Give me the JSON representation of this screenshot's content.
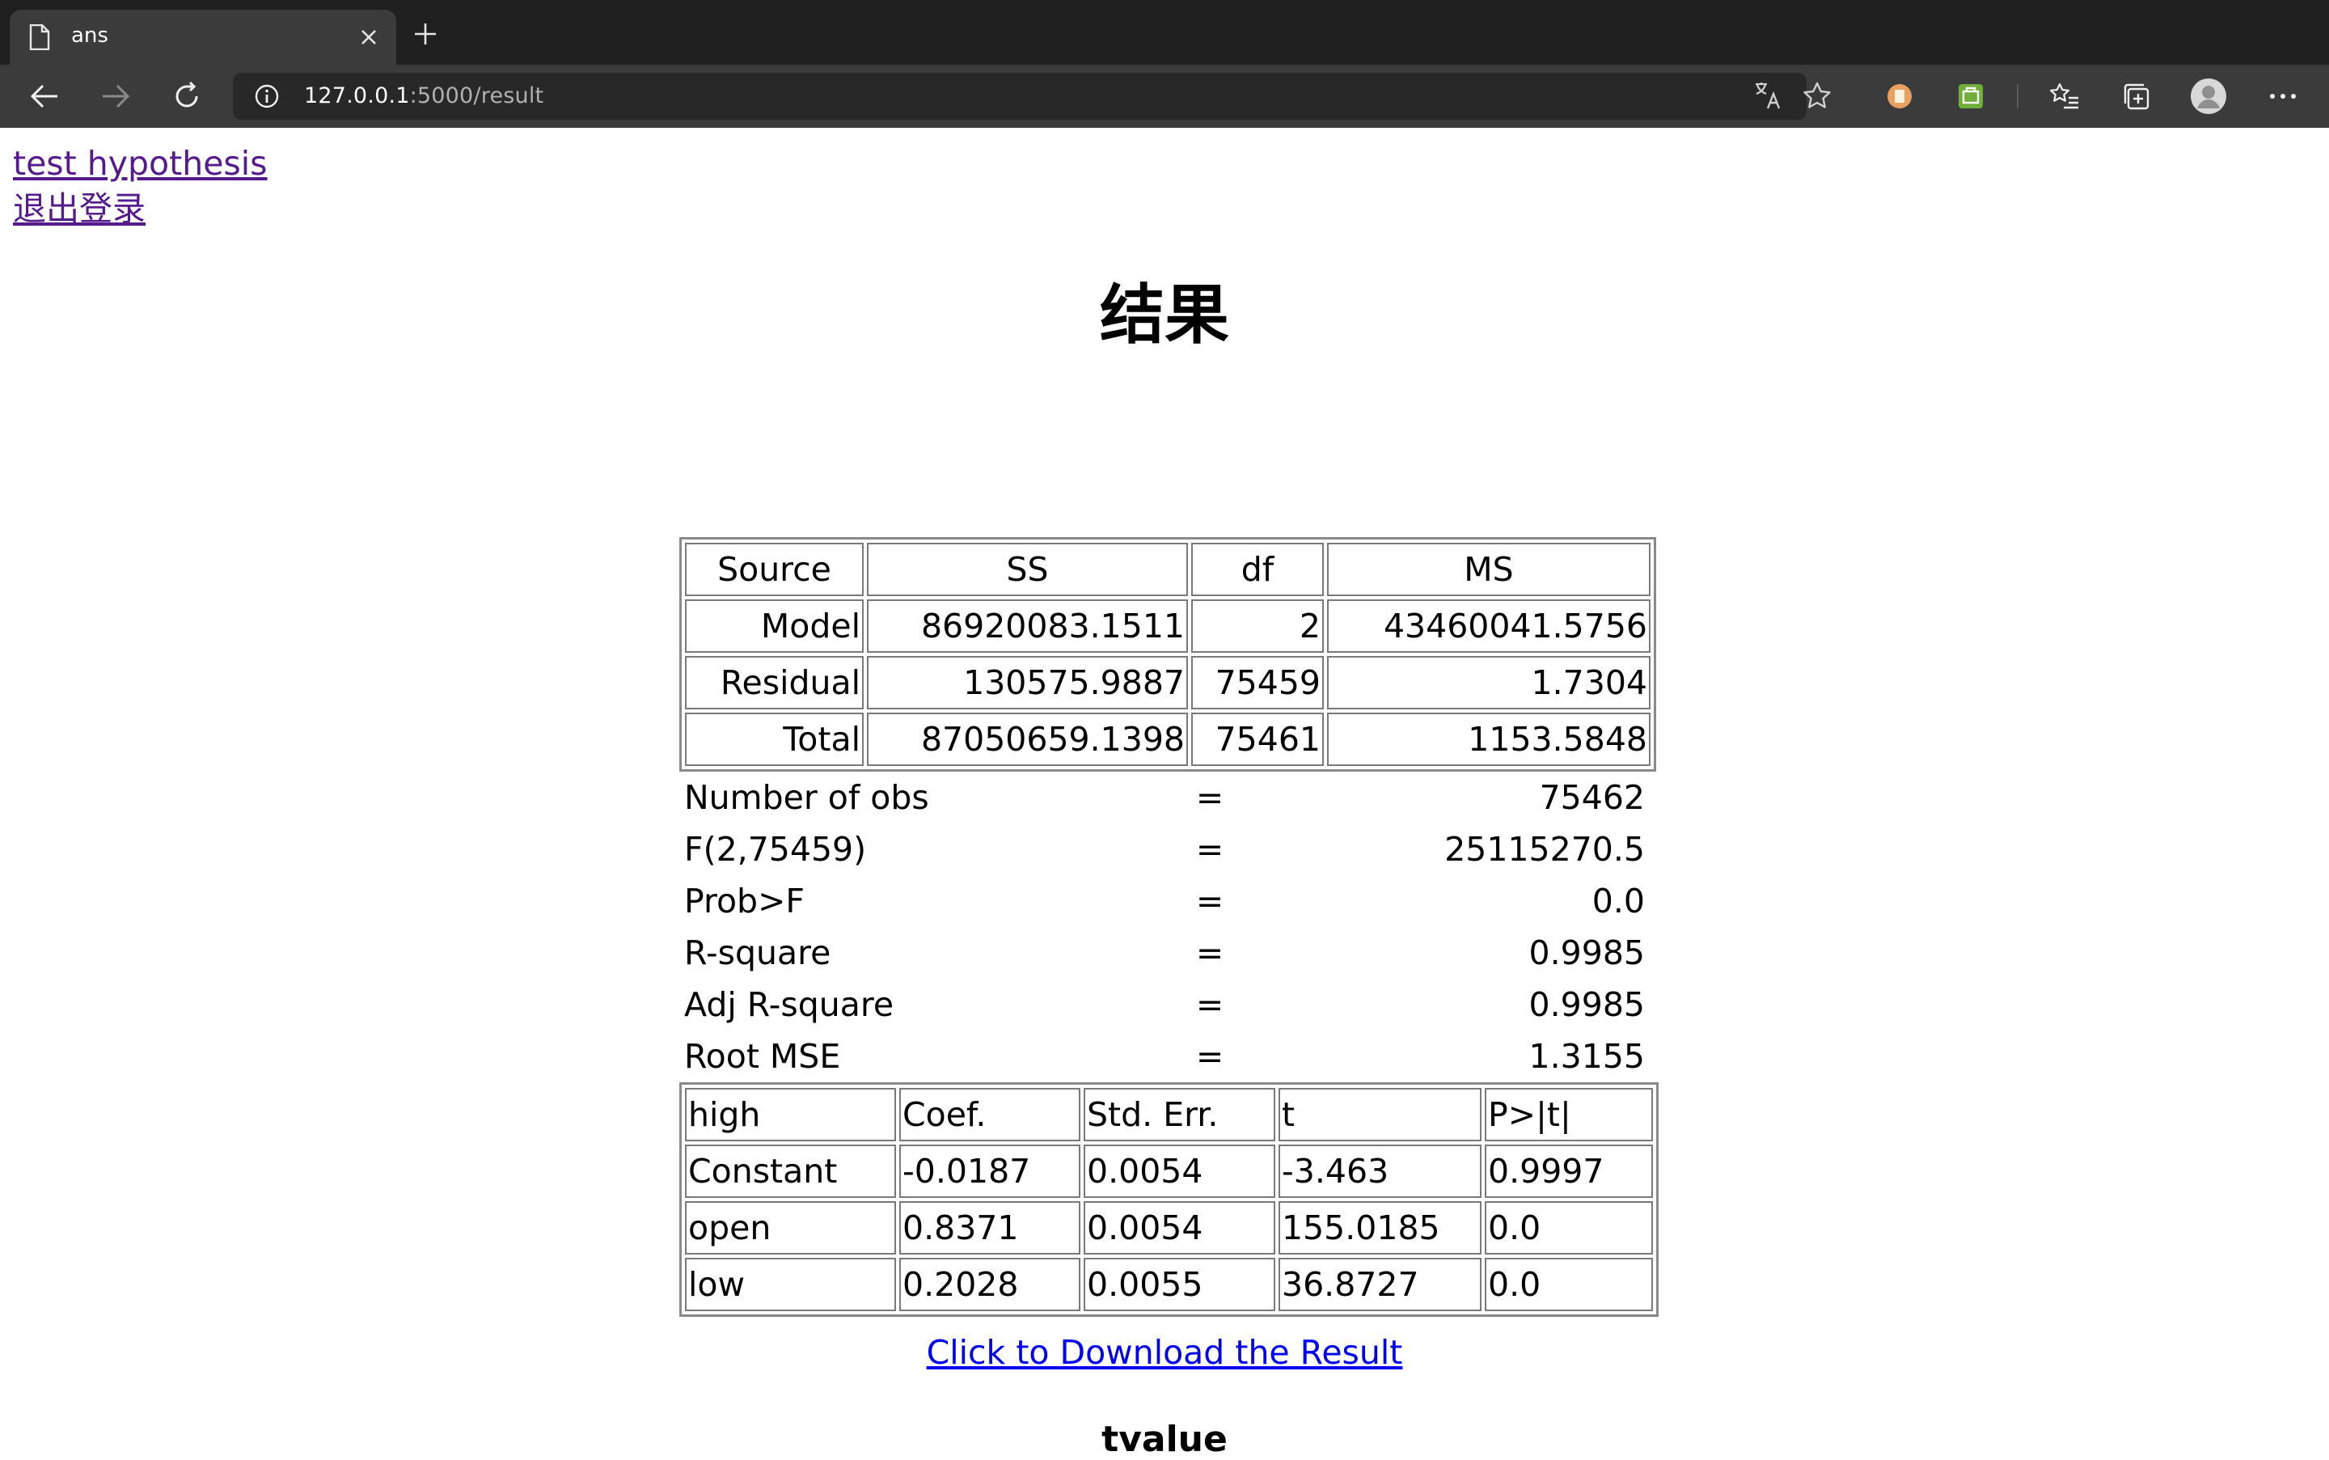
{
  "browser": {
    "tab_title": "ans",
    "url_host": "127.0.0.1",
    "url_path": ":5000/result"
  },
  "nav": {
    "links": [
      "test hypothesis",
      "退出登录"
    ]
  },
  "page": {
    "title": "结果",
    "download_link": "Click to Download the Result",
    "subheading": "tvalue"
  },
  "anova": {
    "headers": [
      "Source",
      "SS",
      "df",
      "MS"
    ],
    "rows": [
      [
        "Model",
        "86920083.1511",
        "2",
        "43460041.5756"
      ],
      [
        "Residual",
        "130575.9887",
        "75459",
        "1.7304"
      ],
      [
        "Total",
        "87050659.1398",
        "75461",
        "1153.5848"
      ]
    ]
  },
  "stats": [
    {
      "label": "Number of obs",
      "eq": "=",
      "value": "75462"
    },
    {
      "label": "F(2,75459)",
      "eq": "=",
      "value": "25115270.5"
    },
    {
      "label": "Prob>F",
      "eq": "=",
      "value": "0.0"
    },
    {
      "label": "R-square",
      "eq": "=",
      "value": "0.9985"
    },
    {
      "label": "Adj R-square",
      "eq": "=",
      "value": "0.9985"
    },
    {
      "label": "Root MSE",
      "eq": "=",
      "value": "1.3155"
    }
  ],
  "coef": {
    "headers": [
      "high",
      "Coef.",
      "Std. Err.",
      "t",
      "P>|t|"
    ],
    "rows": [
      [
        "Constant",
        "-0.0187",
        "0.0054",
        "-3.463",
        "0.9997"
      ],
      [
        "open",
        "0.8371",
        "0.0054",
        "155.0185",
        "0.0"
      ],
      [
        "low",
        "0.2028",
        "0.0055",
        "36.8727",
        "0.0"
      ]
    ]
  }
}
